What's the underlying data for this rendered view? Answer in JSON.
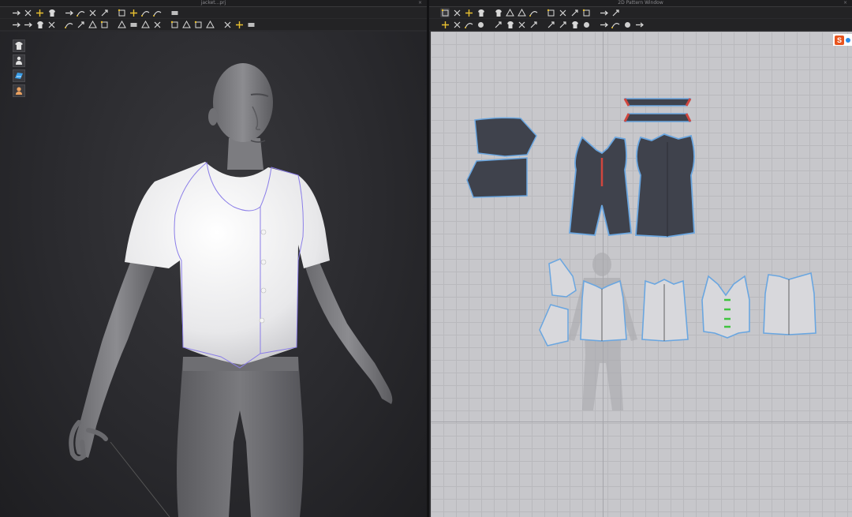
{
  "left_window": {
    "title": "jacket...prj",
    "close_glyph": "×",
    "toolbar_row1": [
      "select-move-icon",
      "add-point-icon",
      "edit-point-icon",
      "edit-curve-icon",
      "transform-icon",
      "pin-icon",
      "fold-icon",
      "tack-icon",
      "shirt-arrange-icon",
      "shirt-pin-icon",
      "scissors-icon",
      "lasso-icon",
      "measure-icon"
    ],
    "toolbar_row2": [
      "avatar-pose-icon",
      "simulate-icon",
      "arrange-point-icon",
      "arrange-plane-icon",
      "fabric-icon",
      "tack-point-icon",
      "hanger-icon",
      "button-icon",
      "buttonhole-icon",
      "zipper-icon",
      "line-icon",
      "puckering-icon",
      "garment-fit-icon",
      "shape-icon",
      "layer-icon",
      "fold-line-icon",
      "move-icon",
      "shirt-icon",
      "shirt-alt-icon"
    ],
    "side_tools": [
      {
        "icon": "shirt-view-icon",
        "color": "#e0e0e0"
      },
      {
        "icon": "avatar-view-icon",
        "color": "#e0e0e0"
      },
      {
        "icon": "fabric-view-icon",
        "color": "#3a9ee8"
      },
      {
        "icon": "skin-view-icon",
        "color": "#e8a060"
      }
    ]
  },
  "right_window": {
    "title": "2D Pattern Window",
    "close_glyph": "×",
    "toolbar_row1": [
      "segment-icon",
      "add-point-icon",
      "edit-point-icon",
      "edit-curve-icon",
      "polygon-icon",
      "rectangle-icon",
      "square-icon",
      "ellipse-icon",
      "internal-rect-icon",
      "internal-square-icon",
      "internal-circle-icon",
      "dart-icon",
      "trace-icon",
      "sewing-icon"
    ],
    "toolbar_row2": [
      "select-icon",
      "transform-icon",
      "edit-pattern-icon",
      "curve-point-icon",
      "pin-icon",
      "tack-icon",
      "fold-icon",
      "seam-icon",
      "segment-sew-icon",
      "free-sew-icon",
      "check-sew-icon",
      "elastic-icon",
      "notch-icon",
      "topstitch-icon",
      "symmetry-icon",
      "mirror-icon"
    ],
    "logo": {
      "letter": "S",
      "brand_color": "#e8541e",
      "accent_color": "#2a8be8"
    }
  },
  "colors": {
    "pattern_fill_dark": "#3f424c",
    "pattern_outline_blue": "#6aa6e0",
    "pattern_fill_light": "#d8d8dc",
    "seam_red": "#d0463e",
    "button_green": "#3fc43f",
    "vest_seam": "#8b7ee8"
  }
}
